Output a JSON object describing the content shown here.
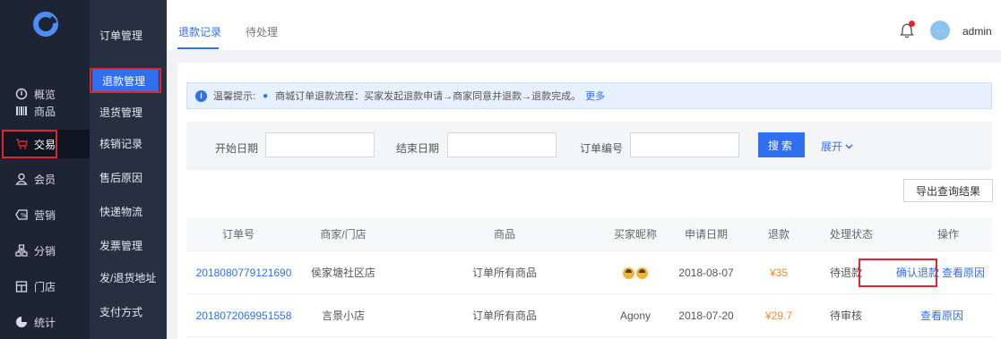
{
  "colors": {
    "accent": "#2f6ff0",
    "highlight_box": "#e3262d",
    "price": "#f08a2e",
    "sidebar_bg": "#1d2433"
  },
  "logo": {
    "icon": "logo-c-icon"
  },
  "nav": {
    "items": [
      {
        "label": "概览",
        "icon": "overview-icon"
      },
      {
        "label": "商品",
        "icon": "barcode-icon"
      },
      {
        "label": "交易",
        "icon": "cart-icon"
      },
      {
        "label": "会员",
        "icon": "user-icon"
      },
      {
        "label": "营销",
        "icon": "coupon-icon"
      },
      {
        "label": "分销",
        "icon": "network-icon"
      },
      {
        "label": "门店",
        "icon": "store-icon"
      },
      {
        "label": "统计",
        "icon": "pie-icon"
      }
    ]
  },
  "submenu": {
    "items": [
      {
        "label": "订单管理"
      },
      {
        "label": "退款管理"
      },
      {
        "label": "退货管理"
      },
      {
        "label": "核销记录"
      },
      {
        "label": "售后原因"
      },
      {
        "label": "快递物流"
      },
      {
        "label": "发票管理"
      },
      {
        "label": "发/退货地址"
      },
      {
        "label": "支付方式"
      }
    ]
  },
  "tabs": [
    {
      "label": "退款记录"
    },
    {
      "label": "待处理"
    }
  ],
  "header": {
    "username": "admin",
    "avatar_text": "· ·"
  },
  "notice": {
    "title": "温馨提示:",
    "text": "商城订单退款流程：买家发起退款申请→商家同意并退款→退款完成。",
    "more": "更多"
  },
  "filters": {
    "start_date_label": "开始日期",
    "end_date_label": "结束日期",
    "order_no_label": "订单编号",
    "start_date_value": "",
    "end_date_value": "",
    "order_no_value": "",
    "search_label": "搜索",
    "expand_label": "展开"
  },
  "export_label": "导出查询结果",
  "table": {
    "headers": [
      "订单号",
      "商家/门店",
      "商品",
      "买家昵称",
      "申请日期",
      "退款",
      "处理状态",
      "操作"
    ],
    "rows": [
      {
        "order_no": "2018080779121690",
        "store": "侯家塘社区店",
        "goods": "订单所有商品",
        "nickname": "",
        "date": "2018-08-07",
        "refund": "¥35",
        "status": "待退款",
        "ops": [
          "确认退款",
          "查看原因"
        ]
      },
      {
        "order_no": "2018072069951558",
        "store": "言景小店",
        "goods": "订单所有商品",
        "nickname": "Agony",
        "date": "2018-07-20",
        "refund": "¥29.7",
        "status": "待审核",
        "ops": [
          "查看原因"
        ]
      }
    ]
  }
}
